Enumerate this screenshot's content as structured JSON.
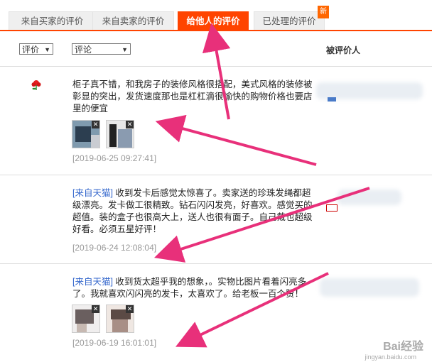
{
  "tabs": [
    {
      "label": "来自买家的评价"
    },
    {
      "label": "来自卖家的评价"
    },
    {
      "label": "给他人的评价"
    },
    {
      "label": "已处理的评价"
    }
  ],
  "new_badge": "新",
  "filters": {
    "rating": "评价",
    "comment": "评论"
  },
  "header_reviewee": "被评价人",
  "reviews": [
    {
      "text": "柜子真不错，和我房子的装修风格很搭配，美式风格的装修被彰显的突出，发货速度那也是杠杠滴很愉快的购物价格也要店里的便宜",
      "date": "[2019-06-25 09:27:41]"
    },
    {
      "source": "[来自天猫]",
      "text": " 收到发卡后感觉太惊喜了。卖家送的珍珠发绳都超级漂亮。发卡做工很精致。钻石闪闪发亮，好喜欢。感觉买的超值。装的盒子也很高大上，送人也很有面子。自己戴也超级好看。必须五星好评！",
      "date": "[2019-06-24 12:08:04]"
    },
    {
      "source": "[来自天猫]",
      "text": " 收到货太超乎我的想象，。实物比图片看着闪亮多了。我就喜欢闪闪亮的发卡，太喜欢了。给老板一百个赞！",
      "date": "[2019-06-19 16:01:01]"
    }
  ],
  "colors": {
    "accent": "#ff4400",
    "arrow": "#e8307a",
    "link": "#3366cc"
  },
  "watermark": {
    "brand": "Bai经验",
    "site": "jingyan.baidu.com"
  }
}
